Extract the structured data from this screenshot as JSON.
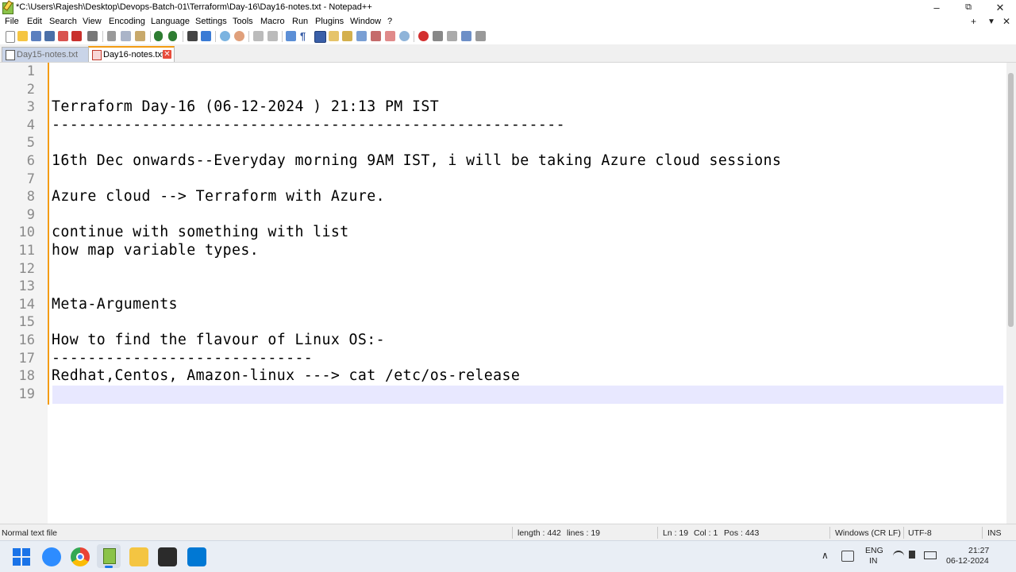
{
  "window": {
    "title": "*C:\\Users\\Rajesh\\Desktop\\Devops-Batch-01\\Terraform\\Day-16\\Day16-notes.txt - Notepad++",
    "minimize": "–",
    "restore": "⧉",
    "close": "✕"
  },
  "menu": {
    "items": [
      "File",
      "Edit",
      "Search",
      "View",
      "Encoding",
      "Language",
      "Settings",
      "Tools",
      "Macro",
      "Run",
      "Plugins",
      "Window",
      "?"
    ],
    "plus": "+",
    "dropdown": "▼",
    "close": "✕"
  },
  "tabs": [
    {
      "label": "Day15-notes.txt",
      "active": false
    },
    {
      "label": "Day16-notes.txt",
      "active": true,
      "close": "✕"
    }
  ],
  "editor": {
    "line_numbers": [
      "1",
      "2",
      "3",
      "4",
      "5",
      "6",
      "7",
      "8",
      "9",
      "10",
      "11",
      "12",
      "13",
      "14",
      "15",
      "16",
      "17",
      "18",
      "19"
    ],
    "lines": [
      "",
      "",
      "Terraform Day-16 (06-12-2024 ) 21:13 PM IST",
      "---------------------------------------------------------",
      "",
      "16th Dec onwards--Everyday morning 9AM IST, i will be taking Azure cloud sessions",
      "",
      "Azure cloud --> Terraform with Azure.",
      "",
      "continue with something with list",
      "how map variable types.",
      "",
      "",
      "Meta-Arguments",
      "",
      "How to find the flavour of Linux OS:-",
      "-----------------------------",
      "Redhat,Centos, Amazon-linux ---> cat /etc/os-release",
      ""
    ],
    "current_line": 19
  },
  "status": {
    "file_type": "Normal text file",
    "length": "length : 442",
    "lines": "lines : 19",
    "ln": "Ln : 19",
    "col": "Col : 1",
    "pos": "Pos : 443",
    "eol": "Windows (CR LF)",
    "encoding": "UTF-8",
    "mode": "INS"
  },
  "taskbar": {
    "lang_top": "ENG",
    "lang_bottom": "IN",
    "time": "21:27",
    "date": "06-12-2024",
    "tray_up": "∧",
    "apps": [
      "start-icon",
      "zoom-icon",
      "chrome-icon",
      "notepadpp-icon",
      "file-explorer-icon",
      "terminal-icon",
      "vscode-icon"
    ]
  },
  "colors": {
    "accent_orange": "#f39c12",
    "current_line": "#e8e8ff",
    "tab_inactive": "#c9d4e8"
  }
}
